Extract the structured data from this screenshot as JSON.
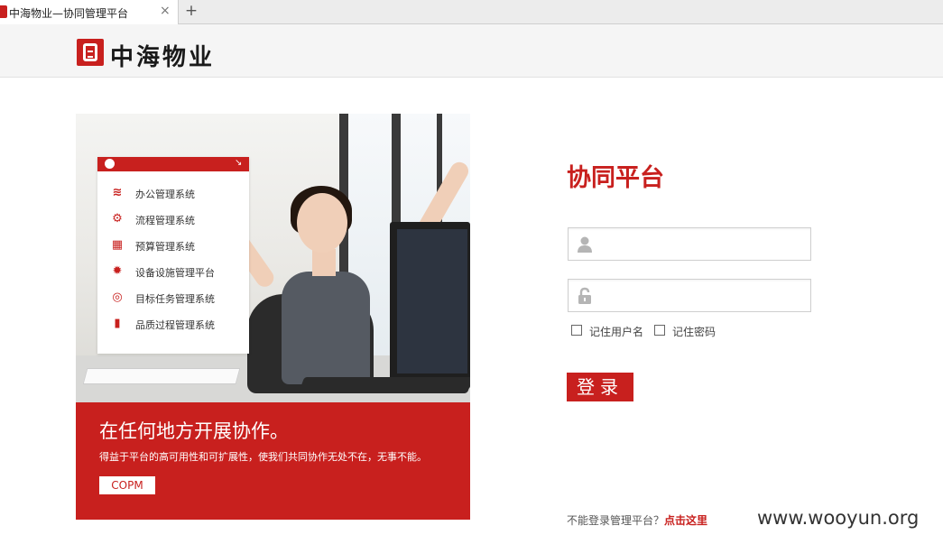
{
  "browser": {
    "tab_title": "中海物业—协同管理平台",
    "close_glyph": "×",
    "new_tab_glyph": "+"
  },
  "header": {
    "logo_text": "中海物业"
  },
  "hero": {
    "menu": {
      "expand_glyph": "↘",
      "items": [
        {
          "label": "办公管理系统",
          "icon": "folder-icon",
          "glyph": "≋"
        },
        {
          "label": "流程管理系统",
          "icon": "workflow-icon",
          "glyph": "⚙"
        },
        {
          "label": "预算管理系统",
          "icon": "calculator-icon",
          "glyph": "▦"
        },
        {
          "label": "设备设施管理平台",
          "icon": "gear-icon",
          "glyph": "✹"
        },
        {
          "label": "目标任务管理系统",
          "icon": "target-icon",
          "glyph": "◎"
        },
        {
          "label": "品质过程管理系统",
          "icon": "bar-chart-icon",
          "glyph": "▮"
        }
      ]
    },
    "headline": "在任何地方开展协作。",
    "subline": "得益于平台的高可用性和可扩展性，使我们共同协作无处不在，无事不能。",
    "tag": "COPM"
  },
  "login": {
    "title": "协同平台",
    "username_value": "",
    "password_value": "",
    "remember_user": "记住用户名",
    "remember_password": "记住密码",
    "submit": "登录",
    "help_text": "不能登录管理平台？",
    "help_link": "点击这里"
  },
  "watermark": "www.wooyun.org",
  "colors": {
    "brand_red": "#c8201e"
  }
}
